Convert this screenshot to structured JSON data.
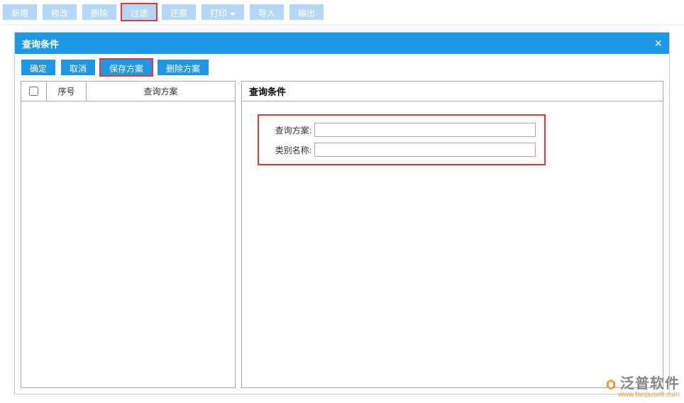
{
  "toolbar": {
    "new": "新增",
    "edit": "修改",
    "delete": "删除",
    "filter": "过滤",
    "restore": "还原",
    "print": "打印",
    "import": "导入",
    "export": "输出"
  },
  "dialog": {
    "title": "查询条件",
    "actions": {
      "confirm": "确定",
      "cancel": "取消",
      "save_plan": "保存方案",
      "delete_plan": "删除方案"
    },
    "table": {
      "seq_header": "序号",
      "plan_header": "查询方案"
    },
    "right": {
      "title": "查询条件",
      "form": {
        "plan_label": "查询方案:",
        "category_label": "类别名称:",
        "plan_value": "",
        "category_value": ""
      }
    }
  },
  "watermark": {
    "brand": "泛普软件",
    "url": "www.fanpusoft.com"
  }
}
